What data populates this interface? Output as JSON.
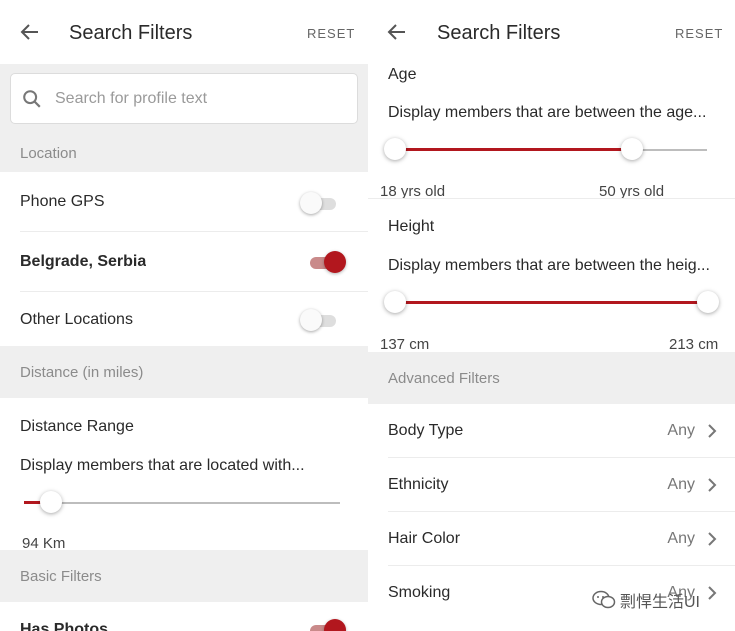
{
  "left": {
    "header": {
      "title": "Search Filters",
      "reset_label": "RESET"
    },
    "search": {
      "placeholder": "Search for profile text",
      "value": ""
    },
    "location": {
      "section_label": "Location",
      "items": [
        {
          "label": "Phone GPS",
          "enabled": false
        },
        {
          "label": "Belgrade, Serbia",
          "enabled": true
        },
        {
          "label": "Other Locations",
          "enabled": false
        }
      ]
    },
    "distance": {
      "section_label": "Distance (in miles)",
      "title": "Distance Range",
      "description": "Display members that are located with...",
      "value_label": "94 Km",
      "value_fraction": 0.06
    },
    "basic": {
      "section_label": "Basic Filters",
      "has_photos_label": "Has Photos",
      "has_photos_enabled": true
    }
  },
  "right": {
    "header": {
      "title": "Search Filters",
      "reset_label": "RESET"
    },
    "age": {
      "title": "Age",
      "description": "Display members that are between the age...",
      "min_label": "18 yrs old",
      "max_label": "50 yrs old",
      "low_fraction": 0.0,
      "high_fraction": 0.76
    },
    "height": {
      "title": "Height",
      "description": "Display members that are between the heig...",
      "min_label": "137 cm",
      "max_label": "213 cm",
      "low_fraction": 0.0,
      "high_fraction": 1.0
    },
    "advanced": {
      "section_label": "Advanced Filters",
      "items": [
        {
          "label": "Body Type",
          "value": "Any"
        },
        {
          "label": "Ethnicity",
          "value": "Any"
        },
        {
          "label": "Hair Color",
          "value": "Any"
        },
        {
          "label": "Smoking",
          "value": "Any"
        }
      ]
    }
  },
  "watermark": {
    "text": "剽悍生活UI",
    "icon": "wechat-icon"
  },
  "colors": {
    "accent": "#b2171e",
    "section_bg": "#efefef",
    "section_text": "#8b8b8b"
  }
}
